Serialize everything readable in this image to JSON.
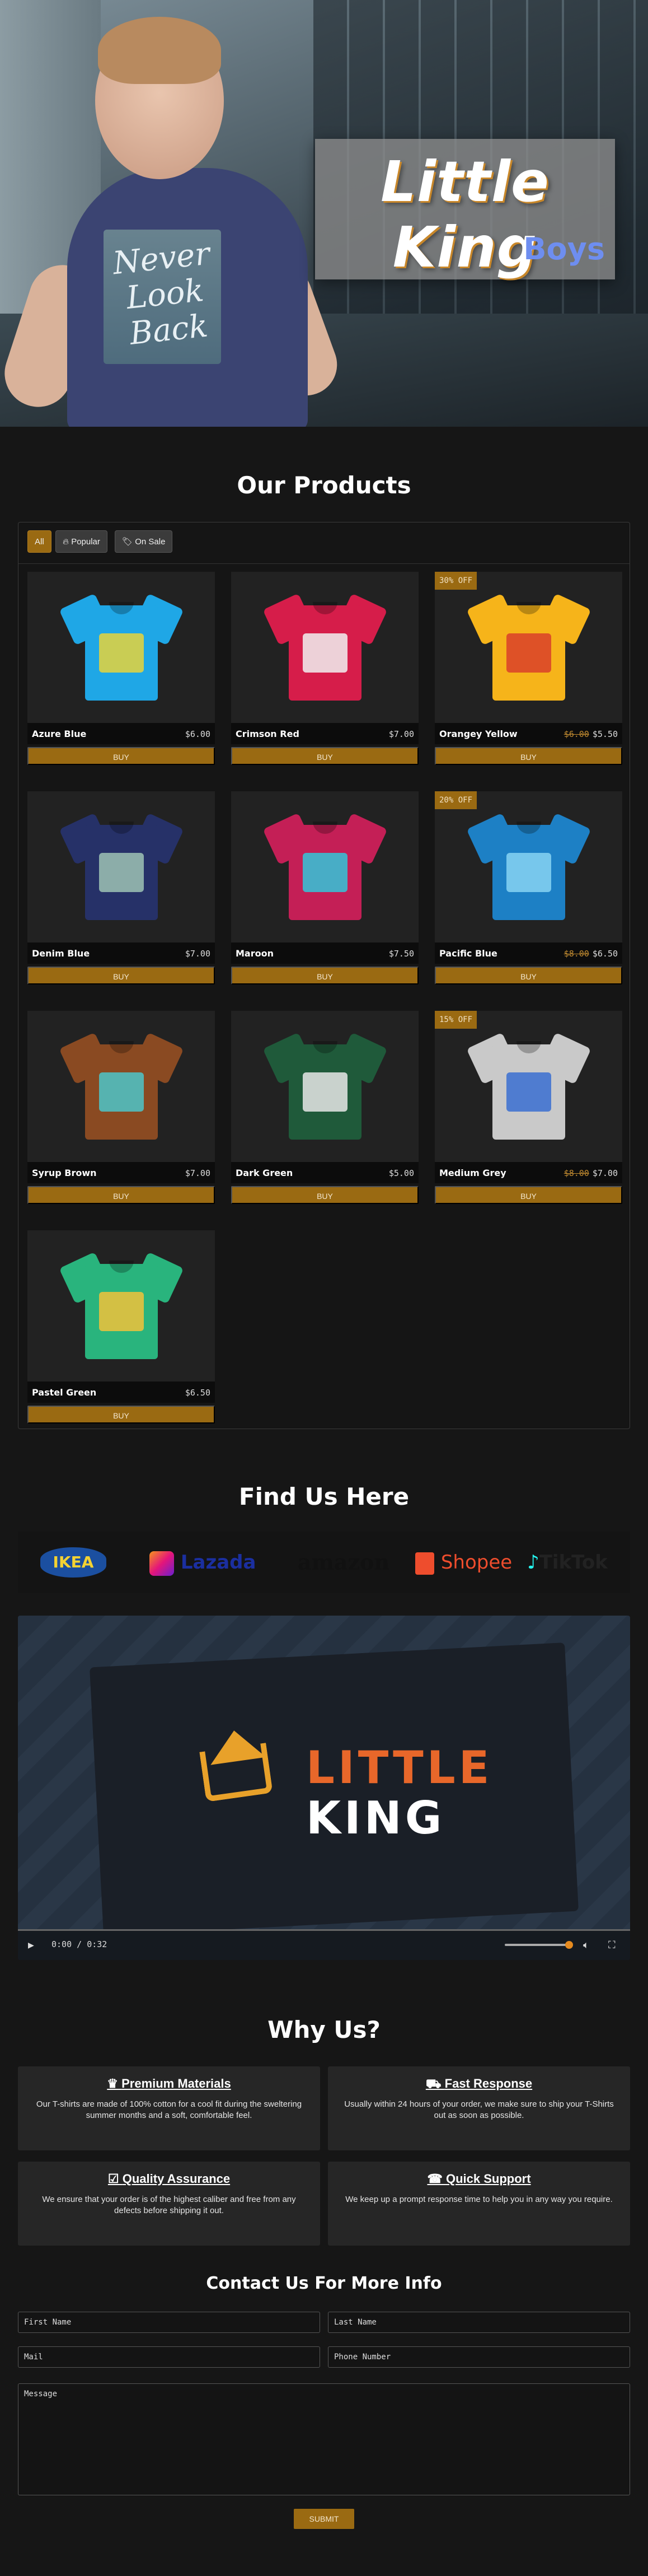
{
  "hero": {
    "title": "Little King",
    "subtitle": "Boys",
    "shirt_text": "Never Look Back"
  },
  "products_section": {
    "title": "Our Products",
    "filters": [
      {
        "label": "All",
        "active": true
      },
      {
        "label": "Popular",
        "icon": "fire-icon"
      },
      {
        "label": "On Sale",
        "icon": "tag-icon"
      }
    ],
    "buy_label": "BUY",
    "items": [
      {
        "name": "Azure Blue",
        "price": "$6.00",
        "old_price": "",
        "badge": "",
        "color": "#1fa7e6",
        "art": "#e8d33a"
      },
      {
        "name": "Crimson Red",
        "price": "$7.00",
        "old_price": "",
        "badge": "",
        "color": "#d61d4a",
        "art": "#f1f1f1"
      },
      {
        "name": "Orangey Yellow",
        "price": "$5.50",
        "old_price": "$6.00",
        "badge": "30% OFF",
        "color": "#f6b41a",
        "art": "#d9402a"
      },
      {
        "name": "Denim Blue",
        "price": "$7.00",
        "old_price": "",
        "badge": "",
        "color": "#263168",
        "art": "#9fc3b5"
      },
      {
        "name": "Maroon",
        "price": "$7.50",
        "old_price": "",
        "badge": "",
        "color": "#c41f56",
        "art": "#33c7d9"
      },
      {
        "name": "Pacific Blue",
        "price": "$6.50",
        "old_price": "$8.00",
        "badge": "20% OFF",
        "color": "#1d80c5",
        "art": "#87d4f2"
      },
      {
        "name": "Syrup Brown",
        "price": "$7.00",
        "old_price": "",
        "badge": "",
        "color": "#8a4a22",
        "art": "#4cc5c9"
      },
      {
        "name": "Dark Green",
        "price": "$5.00",
        "old_price": "",
        "badge": "",
        "color": "#1f5a3a",
        "art": "#e8e8e8"
      },
      {
        "name": "Medium Grey",
        "price": "$7.00",
        "old_price": "$8.00",
        "badge": "15% OFF",
        "color": "#c9c9c9",
        "art": "#3a6fd1"
      },
      {
        "name": "Pastel Green",
        "price": "$6.50",
        "old_price": "",
        "badge": "",
        "color": "#29b47d",
        "art": "#f1c23a"
      }
    ]
  },
  "find_us": {
    "title": "Find Us Here",
    "logos": [
      {
        "label": "IKEA",
        "color": "#f4d232"
      },
      {
        "label": "Lazada",
        "color": "#1b2fa0"
      },
      {
        "label": "amazon",
        "color": "#111111"
      },
      {
        "label": "Shopee",
        "color": "#ee4d2d"
      },
      {
        "label": "TikTok",
        "color": "#222222"
      }
    ]
  },
  "video": {
    "brand_top": "LITTLE",
    "brand_bottom": "KING",
    "time": "0:00 / 0:32"
  },
  "why_us": {
    "title": "Why Us?",
    "cards": [
      {
        "icon": "crown-icon",
        "heading": "Premium Materials",
        "text": "Our T-shirts are made of 100% cotton for a cool fit during the sweltering summer months and a soft, comfortable feel."
      },
      {
        "icon": "truck-icon",
        "heading": "Fast Response",
        "text": "Usually within 24 hours of your order, we make sure to ship your T-Shirts out as soon as possible."
      },
      {
        "icon": "clipboard-check-icon",
        "heading": "Quality Assurance",
        "text": "We ensure that your order is of the highest caliber and free from any defects before shipping it out."
      },
      {
        "icon": "headset-icon",
        "heading": "Quick Support",
        "text": "We keep up a prompt response time to help you in any way you require."
      }
    ]
  },
  "contact": {
    "title": "Contact Us For More Info",
    "first_name": "First Name",
    "last_name": "Last Name",
    "mail": "Mail",
    "phone": "Phone Number",
    "message": "Message",
    "submit": "SUBMIT"
  }
}
